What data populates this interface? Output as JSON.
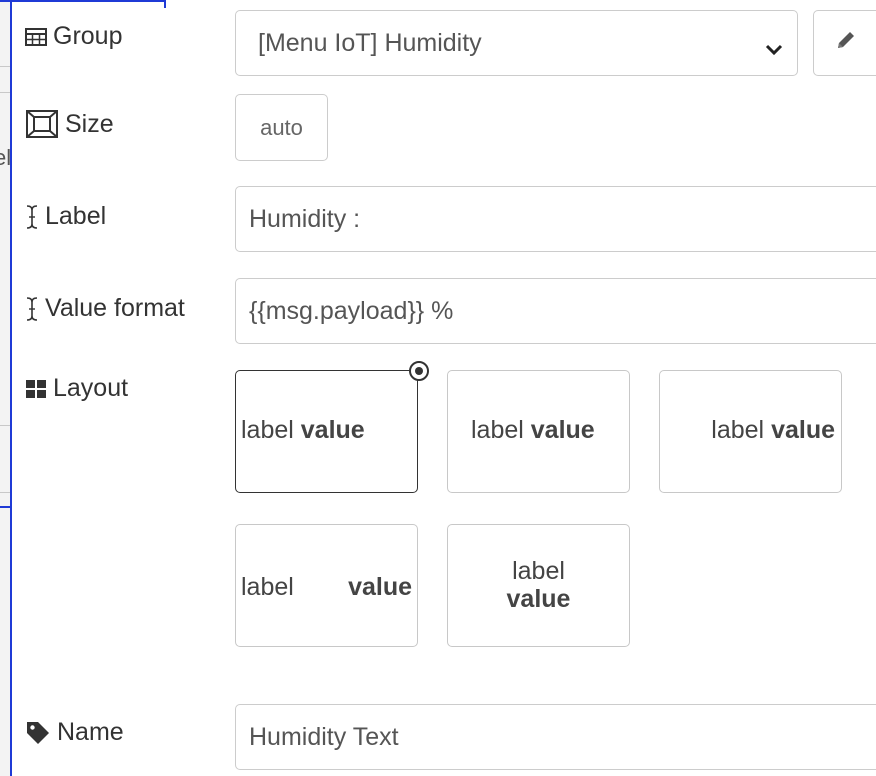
{
  "form": {
    "group": {
      "label": "Group",
      "icon": "table-icon",
      "value": "[Menu IoT] Humidity"
    },
    "size": {
      "label": "Size",
      "icon": "resize-icon",
      "value": "auto"
    },
    "label_field": {
      "label": "Label",
      "icon": "text-cursor-icon",
      "value": "Humidity :"
    },
    "value_format": {
      "label": "Value format",
      "icon": "text-cursor-icon",
      "value": "{{msg.payload}} %"
    },
    "layout": {
      "label": "Layout",
      "icon": "grid-icon",
      "selected_index": 0,
      "options": [
        {
          "label": "label",
          "value": "value"
        },
        {
          "label": "label",
          "value": "value"
        },
        {
          "label": "label",
          "value": "value"
        },
        {
          "label": "label",
          "value": "value"
        },
        {
          "label": "label",
          "value": "value"
        }
      ]
    },
    "name": {
      "label": "Name",
      "icon": "tag-icon",
      "value": "Humidity Text"
    }
  },
  "background": {
    "partial_text": "el"
  },
  "colors": {
    "accent_border": "#1f3ad6",
    "text": "#333333",
    "field_border": "#cccccc"
  }
}
